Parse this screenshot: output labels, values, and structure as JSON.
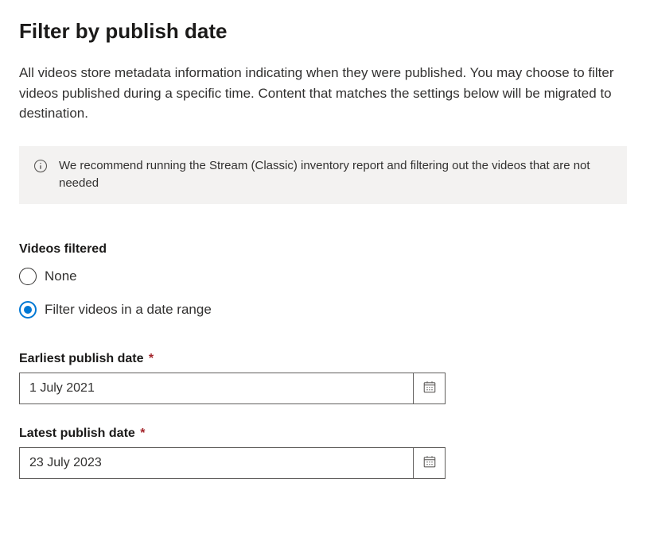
{
  "title": "Filter by publish date",
  "description": "All videos store metadata information indicating when they were published. You may choose to filter videos published during a specific time. Content that matches the settings below will be migrated to destination.",
  "infoMessage": "We recommend running the Stream (Classic) inventory report and filtering out the videos that are not needed",
  "filterSection": {
    "label": "Videos filtered",
    "options": {
      "none": "None",
      "range": "Filter videos in a date range"
    },
    "selected": "range"
  },
  "earliestDate": {
    "label": "Earliest publish date",
    "value": "1 July 2021"
  },
  "latestDate": {
    "label": "Latest publish date",
    "value": "23 July 2023"
  }
}
